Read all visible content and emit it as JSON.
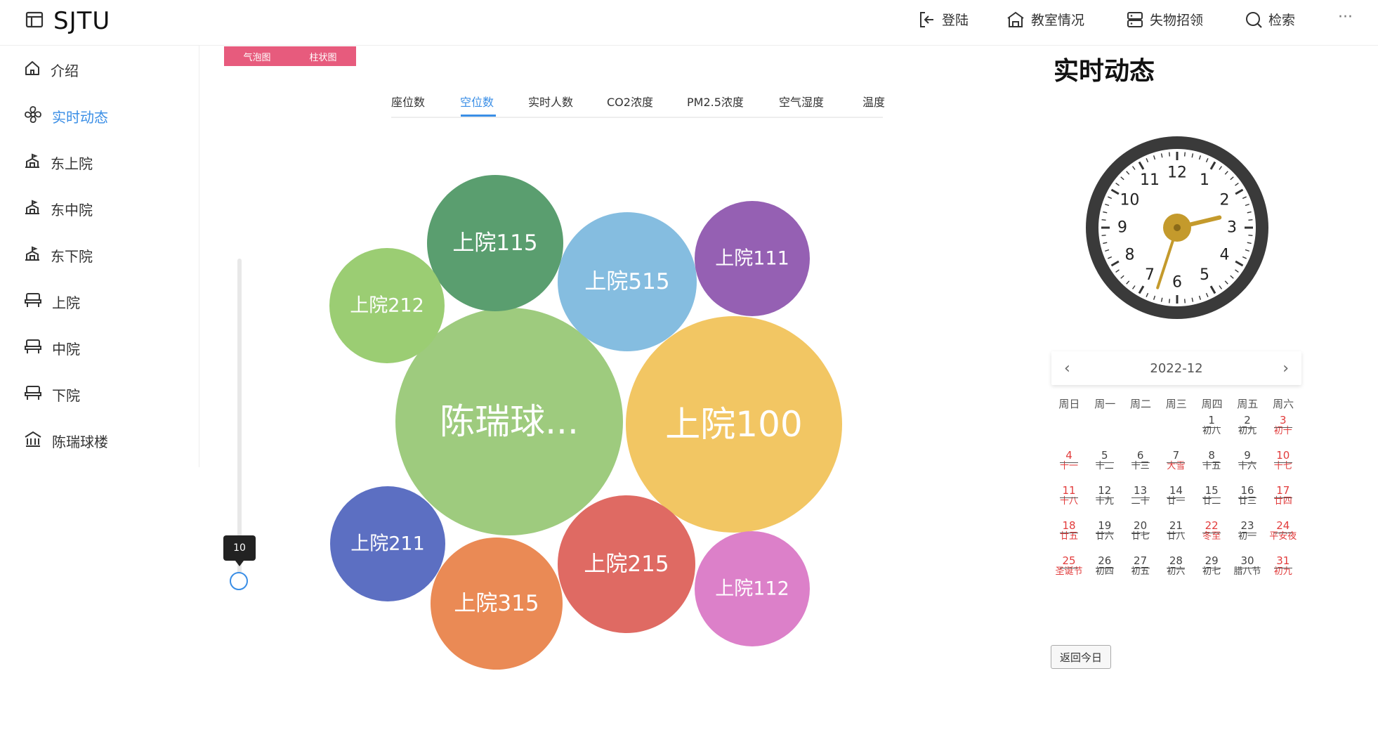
{
  "app": {
    "title": "SJTU"
  },
  "header": {
    "nav": [
      {
        "label": "登陆",
        "icon": "login-icon"
      },
      {
        "label": "教室情况",
        "icon": "building-icon"
      },
      {
        "label": "失物招领",
        "icon": "storage-icon"
      },
      {
        "label": "检索",
        "icon": "search-icon"
      }
    ],
    "more": "···"
  },
  "sidebar": {
    "items": [
      {
        "label": "介绍",
        "icon": "home-icon",
        "active": false
      },
      {
        "label": "实时动态",
        "icon": "fan-icon",
        "active": true
      },
      {
        "label": "东上院",
        "icon": "school-icon",
        "active": false
      },
      {
        "label": "东中院",
        "icon": "school-icon",
        "active": false
      },
      {
        "label": "东下院",
        "icon": "school-icon",
        "active": false
      },
      {
        "label": "上院",
        "icon": "chair-icon",
        "active": false
      },
      {
        "label": "中院",
        "icon": "chair-icon",
        "active": false
      },
      {
        "label": "下院",
        "icon": "chair-icon",
        "active": false
      },
      {
        "label": "陈瑞球楼",
        "icon": "museum-icon",
        "active": false
      }
    ]
  },
  "chart_toggle": {
    "bubble": "气泡图",
    "bar": "柱状图"
  },
  "tabs": [
    {
      "label": "座位数",
      "active": false
    },
    {
      "label": "空位数",
      "active": true
    },
    {
      "label": "实时人数",
      "active": false
    },
    {
      "label": "CO2浓度",
      "active": false
    },
    {
      "label": "PM2.5浓度",
      "active": false
    },
    {
      "label": "空气湿度",
      "active": false
    },
    {
      "label": "温度",
      "active": false
    }
  ],
  "slider": {
    "value": "10"
  },
  "chart_data": {
    "type": "bubble",
    "series": [
      {
        "name": "陈瑞球...",
        "color": "#9ecb7e"
      },
      {
        "name": "上院100",
        "color": "#f2c663"
      },
      {
        "name": "上院115",
        "color": "#5a9e6f"
      },
      {
        "name": "上院515",
        "color": "#85bde0"
      },
      {
        "name": "上院212",
        "color": "#9bcd73"
      },
      {
        "name": "上院111",
        "color": "#9560b3"
      },
      {
        "name": "上院211",
        "color": "#5c6fc2"
      },
      {
        "name": "上院315",
        "color": "#ea8a55"
      },
      {
        "name": "上院215",
        "color": "#df6a63"
      },
      {
        "name": "上院112",
        "color": "#dc80c9"
      }
    ]
  },
  "realtime": {
    "title": "实时动态",
    "clock": {
      "time": "2:33"
    }
  },
  "calendar": {
    "month": "2022-12",
    "prev": "‹",
    "next": "›",
    "weekdays": [
      "周日",
      "周一",
      "周二",
      "周三",
      "周四",
      "周五",
      "周六"
    ],
    "days": [
      {
        "d": "1",
        "l": "初八",
        "col": 4,
        "row": 0
      },
      {
        "d": "2",
        "l": "初九",
        "col": 5,
        "row": 0
      },
      {
        "d": "3",
        "l": "初十",
        "col": 6,
        "row": 0,
        "red": true
      },
      {
        "d": "4",
        "l": "十一",
        "col": 0,
        "row": 1,
        "red": true
      },
      {
        "d": "5",
        "l": "十二",
        "col": 1,
        "row": 1
      },
      {
        "d": "6",
        "l": "十三",
        "col": 2,
        "row": 1
      },
      {
        "d": "7",
        "l": "大雪",
        "col": 3,
        "row": 1,
        "hol": true
      },
      {
        "d": "8",
        "l": "十五",
        "col": 4,
        "row": 1
      },
      {
        "d": "9",
        "l": "十六",
        "col": 5,
        "row": 1
      },
      {
        "d": "10",
        "l": "十七",
        "col": 6,
        "row": 1,
        "red": true
      },
      {
        "d": "11",
        "l": "十八",
        "col": 0,
        "row": 2,
        "red": true
      },
      {
        "d": "12",
        "l": "十九",
        "col": 1,
        "row": 2
      },
      {
        "d": "13",
        "l": "二十",
        "col": 2,
        "row": 2
      },
      {
        "d": "14",
        "l": "廿一",
        "col": 3,
        "row": 2
      },
      {
        "d": "15",
        "l": "廿二",
        "col": 4,
        "row": 2
      },
      {
        "d": "16",
        "l": "廿三",
        "col": 5,
        "row": 2
      },
      {
        "d": "17",
        "l": "廿四",
        "col": 6,
        "row": 2,
        "red": true
      },
      {
        "d": "18",
        "l": "廿五",
        "col": 0,
        "row": 3,
        "red": true
      },
      {
        "d": "19",
        "l": "廿六",
        "col": 1,
        "row": 3
      },
      {
        "d": "20",
        "l": "廿七",
        "col": 2,
        "row": 3
      },
      {
        "d": "21",
        "l": "廿八",
        "col": 3,
        "row": 3
      },
      {
        "d": "22",
        "l": "冬至",
        "col": 4,
        "row": 3,
        "red": true
      },
      {
        "d": "23",
        "l": "初一",
        "col": 5,
        "row": 3
      },
      {
        "d": "24",
        "l": "平安夜",
        "col": 6,
        "row": 3,
        "red": true
      },
      {
        "d": "25",
        "l": "圣诞节",
        "col": 0,
        "row": 4,
        "red": true
      },
      {
        "d": "26",
        "l": "初四",
        "col": 1,
        "row": 4
      },
      {
        "d": "27",
        "l": "初五",
        "col": 2,
        "row": 4
      },
      {
        "d": "28",
        "l": "初六",
        "col": 3,
        "row": 4
      },
      {
        "d": "29",
        "l": "初七",
        "col": 4,
        "row": 4
      },
      {
        "d": "30",
        "l": "腊八节",
        "col": 5,
        "row": 4
      },
      {
        "d": "31",
        "l": "初九",
        "col": 6,
        "row": 4,
        "red": true
      }
    ],
    "today_button": "返回今日"
  }
}
